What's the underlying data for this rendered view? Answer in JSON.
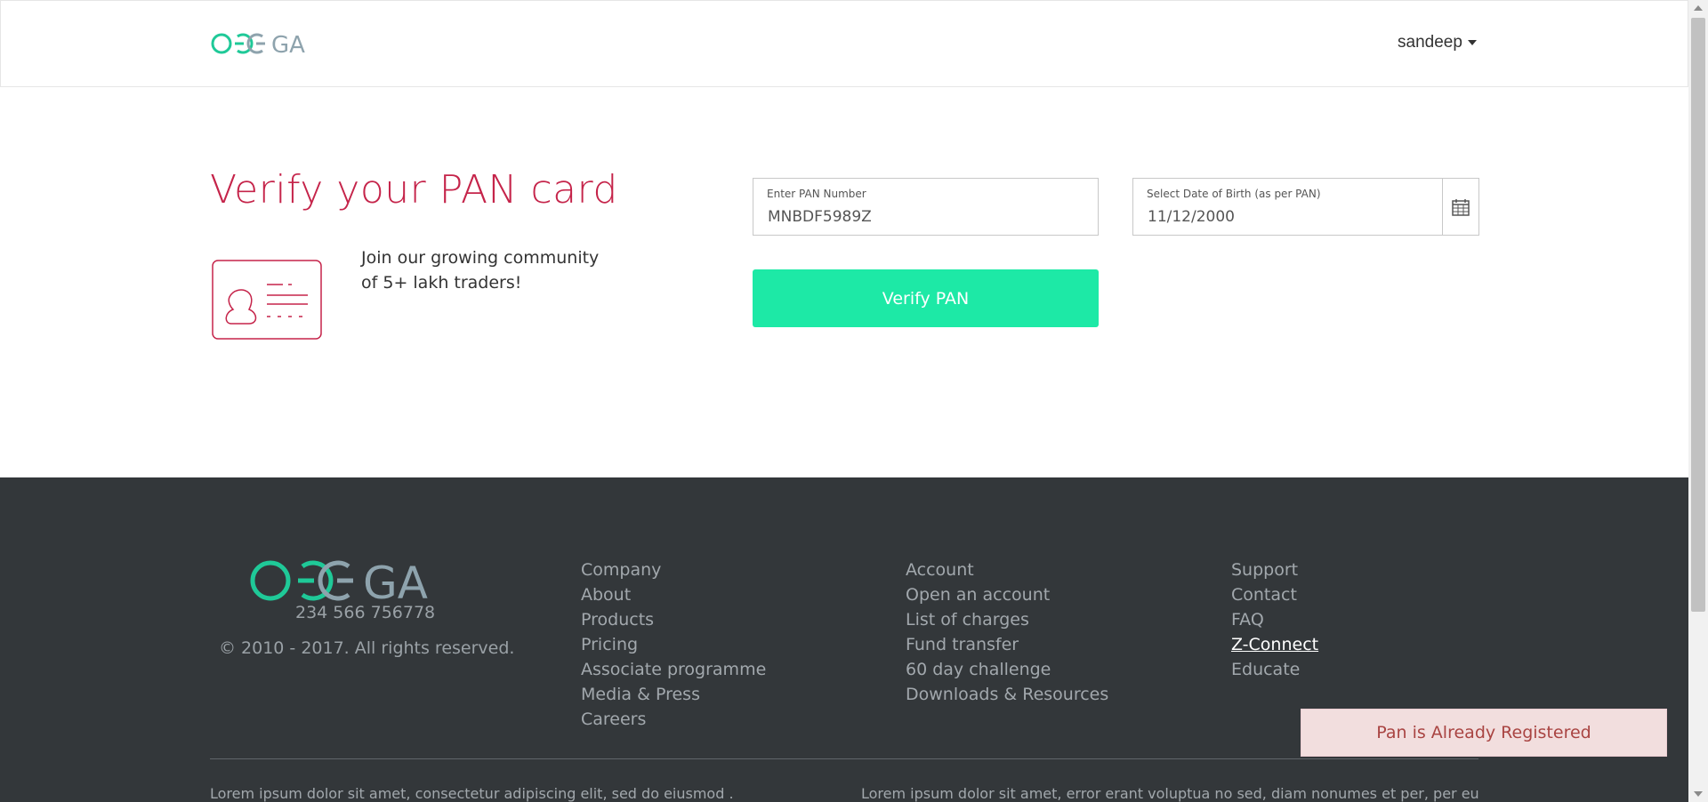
{
  "header": {
    "logo_text": "OMEGA",
    "user_name": "sandeep"
  },
  "main": {
    "title": "Verify your PAN card",
    "community_text": "Join our growing community of 5+ lakh traders!",
    "pan_field": {
      "label": "Enter PAN Number",
      "value": "MNBDF5989Z"
    },
    "dob_field": {
      "label": "Select Date of Birth (as per PAN)",
      "value": "11/12/2000"
    },
    "verify_button": "Verify PAN"
  },
  "footer": {
    "logo_text": "OMEGA",
    "phone": "234 566 756778",
    "copyright": "© 2010 - 2017. All rights reserved.",
    "col1": [
      "Company",
      "About",
      "Products",
      "Pricing",
      "Associate programme",
      "Media & Press",
      "Careers"
    ],
    "col2": [
      "Account",
      "Open an account",
      "List of charges",
      "Fund transfer",
      "60 day challenge",
      "Downloads & Resources"
    ],
    "col3": [
      "Support",
      "Contact",
      "FAQ",
      "Z-Connect",
      "Educate"
    ],
    "lorem_left": "Lorem ipsum dolor sit amet, consectetur adipiscing elit, sed do eiusmod .",
    "lorem_right": "Lorem ipsum dolor sit amet, error erant voluptua no sed, diam nonumes et per, per eu"
  },
  "toast": {
    "message": "Pan is Already Registered"
  },
  "colors": {
    "accent": "#1de9a6",
    "title": "#c5244a",
    "footer_bg": "#33373a",
    "toast_bg": "#f2dede",
    "toast_text": "#a94442"
  },
  "icons": [
    "omega-logo",
    "pan-card-icon",
    "calendar-icon",
    "caret-down-icon"
  ]
}
